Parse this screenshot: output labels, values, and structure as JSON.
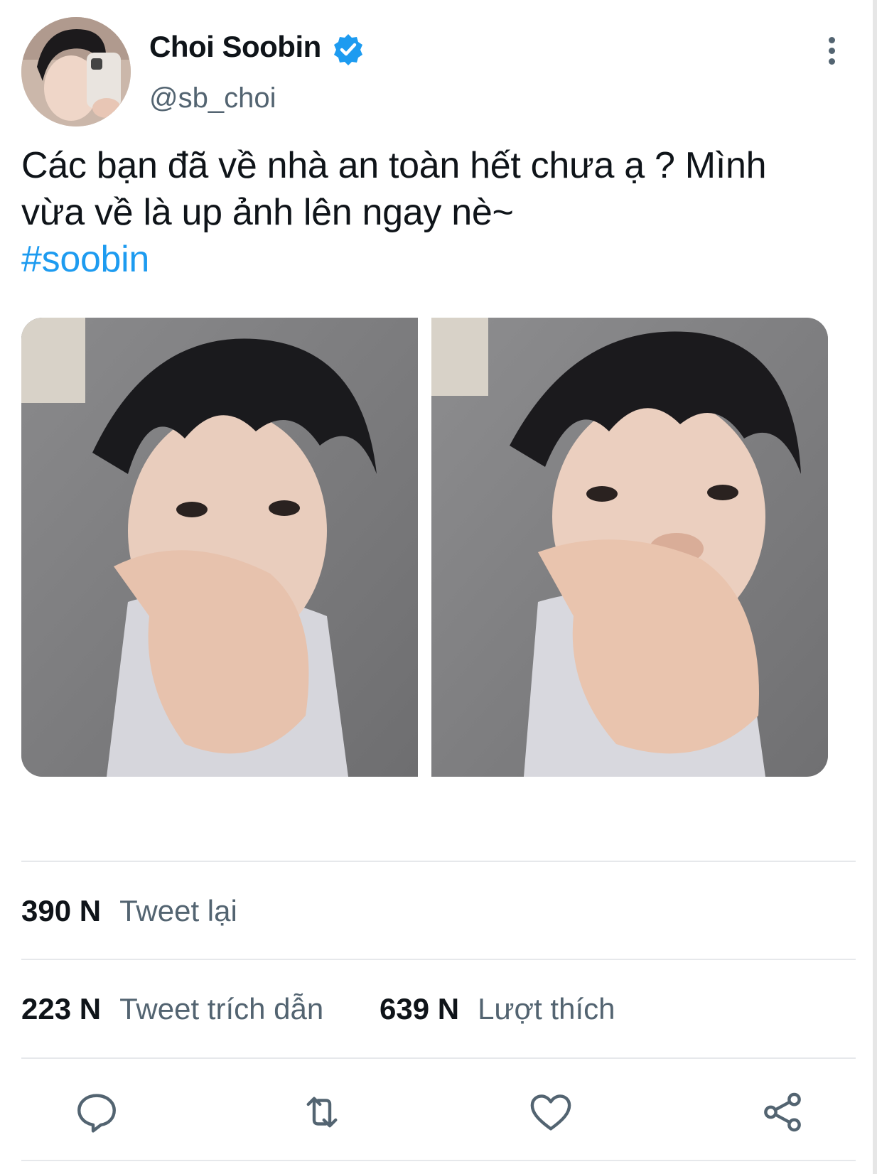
{
  "user": {
    "display_name": "Choi Soobin",
    "handle": "@sb_choi",
    "verified": true
  },
  "tweet": {
    "text_line1": "Các bạn đã về nhà an toàn hết chưa ạ ? Mình",
    "text_line2": "vừa về là up ảnh lên ngay nè~",
    "hashtag": "#soobin"
  },
  "stats": {
    "retweets_count": "390 N",
    "retweets_label": "Tweet lại",
    "quotes_count": "223 N",
    "quotes_label": "Tweet trích dẫn",
    "likes_count": "639 N",
    "likes_label": "Lượt thích"
  },
  "actions": [
    "reply-icon",
    "retweet-icon",
    "like-icon",
    "share-icon"
  ],
  "colors": {
    "link": "#1d9bf0",
    "secondary_text": "#536471",
    "primary_text": "#0f1419",
    "divider": "#e6e8eb"
  }
}
